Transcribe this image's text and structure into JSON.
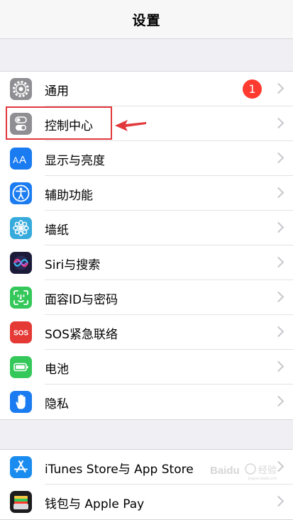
{
  "header": {
    "title": "设置"
  },
  "groups": [
    {
      "items": [
        {
          "label": "通用",
          "icon": "gear-icon",
          "color": "#8e8e93",
          "badge": "1"
        },
        {
          "label": "控制中心",
          "icon": "toggle-switches-icon",
          "color": "#8e8e93"
        },
        {
          "label": "显示与亮度",
          "icon": "text-size-icon",
          "color": "#1a7cf0"
        },
        {
          "label": "辅助功能",
          "icon": "accessibility-icon",
          "color": "#1a7cf0"
        },
        {
          "label": "墙纸",
          "icon": "flower-icon",
          "color": "#36aadc"
        },
        {
          "label": "Siri与搜索",
          "icon": "siri-icon",
          "color": "#1c1c3a"
        },
        {
          "label": "面容ID与密码",
          "icon": "face-id-icon",
          "color": "#34c759"
        },
        {
          "label": "SOS紧急联络",
          "icon": "sos-icon",
          "color": "#e53935"
        },
        {
          "label": "电池",
          "icon": "battery-icon",
          "color": "#34c759"
        },
        {
          "label": "隐私",
          "icon": "hand-icon",
          "color": "#1a7cf0"
        }
      ]
    },
    {
      "items": [
        {
          "label": "iTunes Store与 App Store",
          "icon": "app-store-icon",
          "color": "#1a8cf0"
        },
        {
          "label": "钱包与 Apple Pay",
          "icon": "wallet-icon",
          "color": "#1c1c1e"
        }
      ]
    }
  ],
  "annotation": {
    "highlight_color": "#e2383c"
  },
  "watermark": {
    "text": "Baidu 经验",
    "sub": "jingyan.baidu.com"
  }
}
